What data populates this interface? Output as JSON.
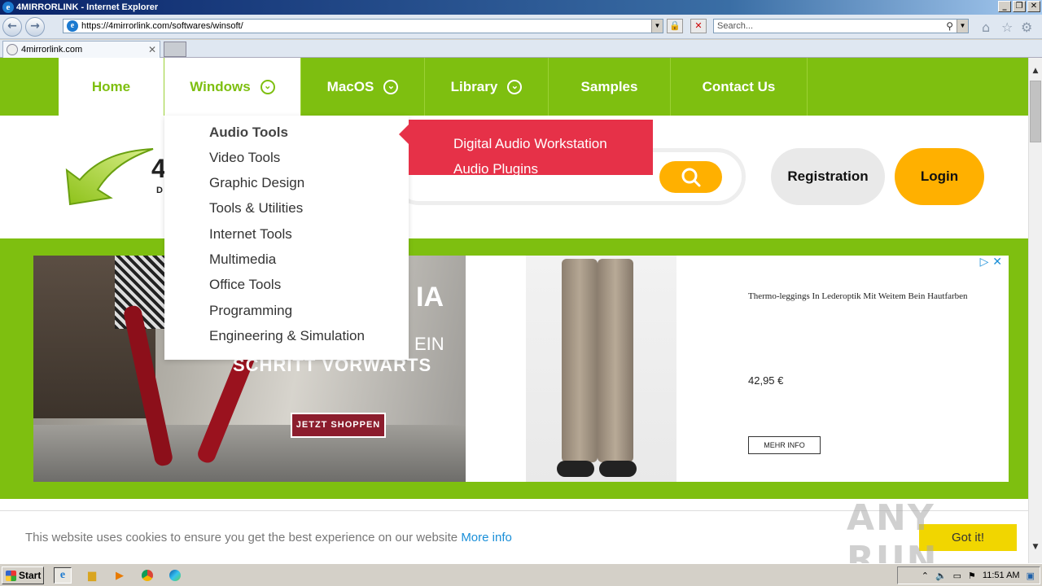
{
  "window": {
    "title": "4MIRRORLINK - Internet Explorer",
    "controls": [
      "_",
      "❐",
      "✕"
    ]
  },
  "browser": {
    "address": "https://4mirrorlink.com/softwares/winsoft/",
    "search_placeholder": "Search...",
    "tab_label": "4mirrorlink.com"
  },
  "nav": {
    "items": [
      {
        "label": "Home"
      },
      {
        "label": "Windows"
      },
      {
        "label": "MacOS"
      },
      {
        "label": "Library"
      },
      {
        "label": "Samples"
      },
      {
        "label": "Contact Us"
      }
    ]
  },
  "header": {
    "logo_text": "4",
    "logo_sub": "D",
    "registration": "Registration",
    "login": "Login"
  },
  "dropdown": {
    "items": [
      {
        "label": "Audio Tools"
      },
      {
        "label": "Video Tools"
      },
      {
        "label": "Graphic Design"
      },
      {
        "label": "Tools & Utilities"
      },
      {
        "label": "Internet Tools"
      },
      {
        "label": "Multimedia"
      },
      {
        "label": "Office Tools"
      },
      {
        "label": "Programming"
      },
      {
        "label": "Engineering & Simulation"
      }
    ]
  },
  "submenu": {
    "items": [
      {
        "label": "Digital Audio Workstation"
      },
      {
        "label": "Audio Plugins"
      }
    ]
  },
  "ad_left": {
    "headline": "IA",
    "line1": "EIN",
    "line2": "SCHRITT VORWARTS",
    "cta": "JETZT SHOPPEN"
  },
  "ad_right": {
    "title": "Thermo-leggings In Lederoptik Mit Weitem Bein Hautfarben",
    "price": "42,95 €",
    "cta": "MEHR INFO"
  },
  "cookie": {
    "message": "This website uses cookies to ensure you get the best experience on our website",
    "more": "More info",
    "accept": "Got it!"
  },
  "watermark": "ANY RUN",
  "taskbar": {
    "start": "Start",
    "clock": "11:51 AM"
  },
  "colors": {
    "brand_green": "#7ebf10",
    "accent_orange": "#ffb000",
    "submenu_red": "#e63148",
    "cookie_yellow": "#f1d600"
  }
}
